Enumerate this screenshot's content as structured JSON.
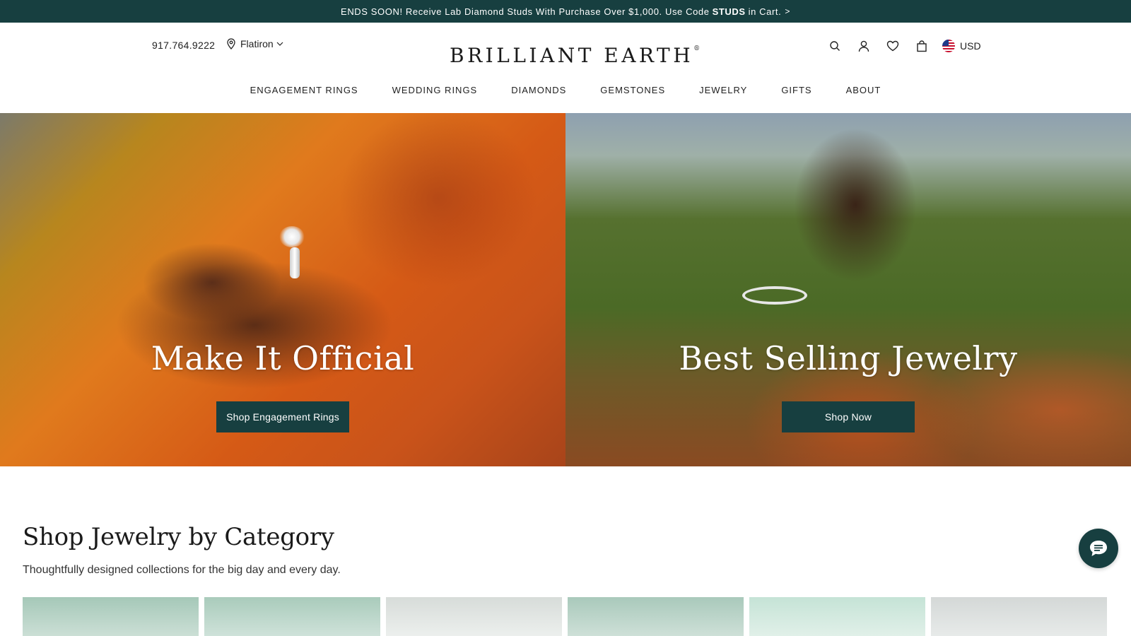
{
  "promo": {
    "text_before": "ENDS SOON! Receive Lab Diamond Studs With Purchase Over $1,000. Use Code",
    "code": "STUDS",
    "text_after": "in Cart.",
    "chevron": ">"
  },
  "header": {
    "phone": "917.764.9222",
    "location": "Flatiron",
    "logo": "BRILLIANT EARTH",
    "logo_mark": "®",
    "currency": "USD",
    "icons": [
      "search-icon",
      "account-icon",
      "wishlist-heart-icon",
      "shopping-bag-icon",
      "us-flag-icon"
    ]
  },
  "nav": {
    "items": [
      "ENGAGEMENT RINGS",
      "WEDDING RINGS",
      "DIAMONDS",
      "GEMSTONES",
      "JEWELRY",
      "GIFTS",
      "ABOUT"
    ]
  },
  "hero": [
    {
      "title": "Make It Official",
      "button": "Shop Engagement Rings"
    },
    {
      "title": "Best Selling Jewelry",
      "button": "Shop Now"
    }
  ],
  "category": {
    "title": "Shop Jewelry by Category",
    "subtitle": "Thoughtfully designed collections for the big day and every day."
  },
  "colors": {
    "brand": "#173f40",
    "text": "#222222",
    "background": "#ffffff"
  }
}
